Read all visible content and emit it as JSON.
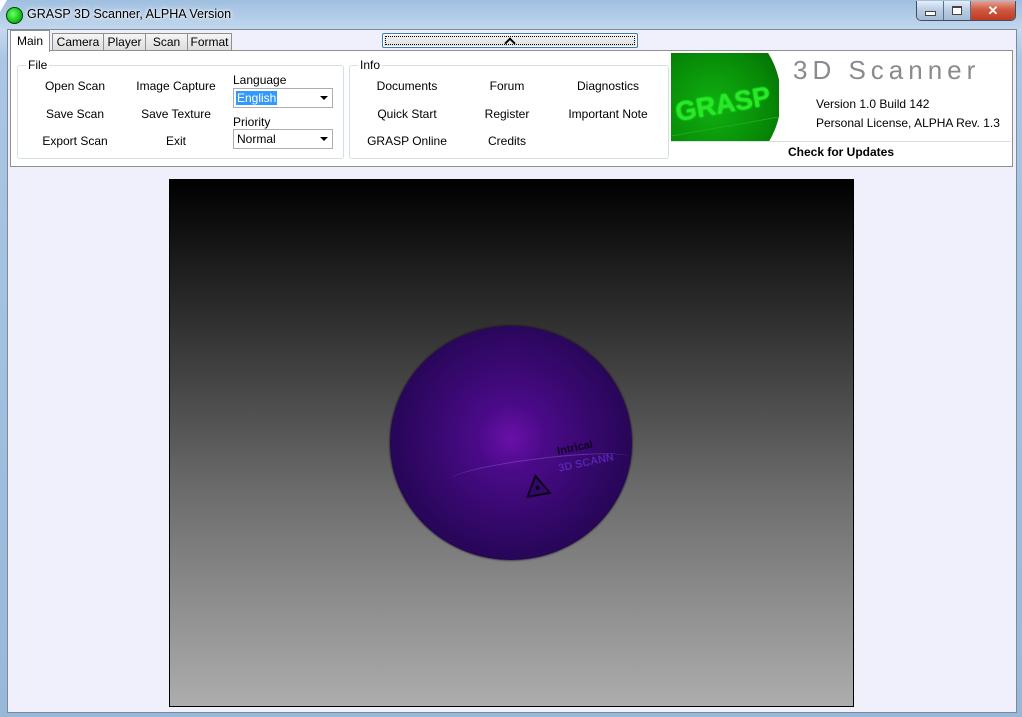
{
  "window": {
    "title": "GRASP 3D Scanner, ALPHA Version",
    "controls": {
      "minimize": "minimize",
      "maximize": "maximize",
      "close": "✕"
    }
  },
  "tabs": [
    {
      "label": "Main",
      "active": true
    },
    {
      "label": "Camera",
      "active": false
    },
    {
      "label": "Player",
      "active": false
    },
    {
      "label": "Scan",
      "active": false
    },
    {
      "label": "Format",
      "active": false
    }
  ],
  "collapse_button": {
    "icon": "chevron-up-icon"
  },
  "file_group": {
    "label": "File",
    "buttons": [
      "Open Scan",
      "Image Capture",
      "Save Scan",
      "Save Texture",
      "Export Scan",
      "Exit"
    ],
    "language": {
      "label": "Language",
      "value": "English"
    },
    "priority": {
      "label": "Priority",
      "value": "Normal"
    }
  },
  "info_group": {
    "label": "Info",
    "buttons": [
      "Documents",
      "Forum",
      "Diagnostics",
      "Quick Start",
      "Register",
      "Important Note",
      "GRASP Online",
      "Credits"
    ]
  },
  "about": {
    "logo_text": "GRASP",
    "product_title": "3D Scanner",
    "version": "Version 1.0  Build 142",
    "license": "Personal License, ALPHA Rev. 1.3",
    "check_updates": "Check for Updates"
  },
  "viewport": {
    "model_text_1": "Intrical",
    "model_text_2": "3D SCANN",
    "colors": {
      "model": "#34086a",
      "background_top": "#000000",
      "background_bottom": "#adadad"
    }
  }
}
